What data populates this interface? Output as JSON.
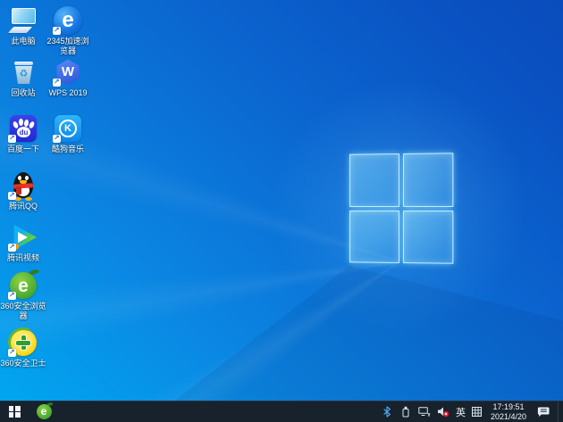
{
  "desktop": {
    "icons": [
      {
        "name": "this-pc",
        "label": "此电脑",
        "shortcut": false
      },
      {
        "name": "2345-accelerated-browser",
        "label": "2345加速浏览器",
        "shortcut": true
      },
      {
        "name": "recycle-bin",
        "label": "回收站",
        "shortcut": false
      },
      {
        "name": "wps-2019",
        "label": "WPS 2019",
        "shortcut": true
      },
      {
        "name": "baidu-search",
        "label": "百度一下",
        "shortcut": true
      },
      {
        "name": "kugou-music",
        "label": "酷狗音乐",
        "shortcut": true
      },
      {
        "name": "tencent-qq",
        "label": "腾讯QQ",
        "shortcut": true
      },
      {
        "name": "tencent-video",
        "label": "腾讯视频",
        "shortcut": true
      },
      {
        "name": "360-secure-browser",
        "label": "360安全浏览器",
        "shortcut": true
      },
      {
        "name": "360-safeguard",
        "label": "360安全卫士",
        "shortcut": true
      }
    ],
    "recycle_symbol": "♻"
  },
  "taskbar": {
    "start_icon": "windows-logo",
    "pinned_icons": [
      "360-secure-browser"
    ],
    "tray": {
      "icons": [
        "bluetooth-icon",
        "usb-device-icon",
        "network-icon",
        "volume-muted-icon"
      ],
      "ime_language": "英",
      "ime_keyboard_icon": "ime-grid-icon",
      "clock": {
        "time": "17:19:51",
        "date": "2021/4/20"
      },
      "action_center_icon": "action-center-icon"
    }
  },
  "colors": {
    "wallpaper_light": "#00a9f2",
    "wallpaper_dark": "#0a4cbc",
    "logo_glow": "#9fe8ff",
    "taskbar_bg": "#17222d",
    "bluetooth_blue": "#49aaf0",
    "mute_badge_red": "#e81123"
  }
}
